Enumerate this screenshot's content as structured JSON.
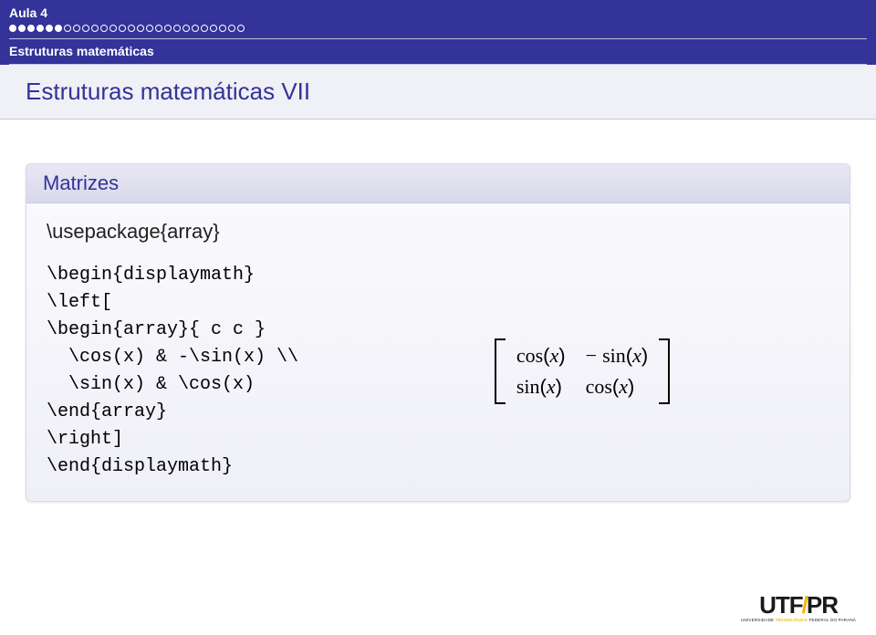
{
  "header": {
    "section": "Aula 4",
    "subsection": "Estruturas matemáticas"
  },
  "frame_title": "Estruturas matemáticas VII",
  "block": {
    "title": "Matrizes",
    "usepackage": "\\usepackage{array}",
    "code": "\\begin{displaymath}\n\\left[\n\\begin{array}{ c c }\n  \\cos(x) & -\\sin(x) \\\\\n  \\sin(x) & \\cos(x)\n\\end{array}\n\\right]\n\\end{displaymath}",
    "matrix": {
      "a11_fn": "cos",
      "a11_arg": "x",
      "a12_sign": "−",
      "a12_fn": "sin",
      "a12_arg": "x",
      "a21_fn": "sin",
      "a21_arg": "x",
      "a22_fn": "cos",
      "a22_arg": "x"
    }
  },
  "progress": {
    "filled": 6,
    "empty": 20
  },
  "logo": {
    "text_left": "UTF",
    "text_right": "PR",
    "subtitle_a": "UNIVERSIDADE ",
    "subtitle_b": "TECNOLÓGICA",
    "subtitle_c": " FEDERAL DO PARANÁ"
  }
}
